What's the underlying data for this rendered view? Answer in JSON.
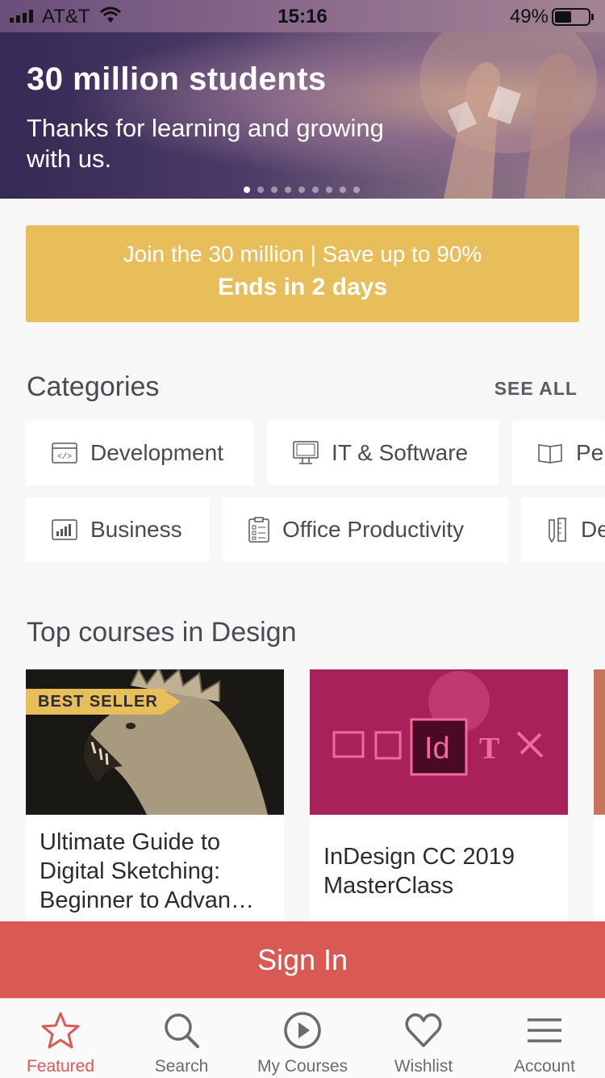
{
  "status_bar": {
    "carrier": "AT&T",
    "time": "15:16",
    "battery": "49%"
  },
  "hero": {
    "title": "30 million students",
    "subtitle": "Thanks for learning and growing with us.",
    "slide_count": 9,
    "active_slide": 1
  },
  "promo": {
    "line1": "Join the 30 million | Save up to 90%",
    "line2": "Ends in 2 days"
  },
  "categories": {
    "title": "Categories",
    "see_all": "SEE ALL",
    "row1": [
      "Development",
      "IT & Software",
      "Per"
    ],
    "row2": [
      "Business",
      "Office Productivity",
      "De"
    ]
  },
  "top_courses": {
    "title": "Top courses in Design",
    "cards": [
      {
        "badge": "BEST SELLER",
        "title": "Ultimate Guide to Digital Sketching: Beginner to Advan…"
      },
      {
        "title": "InDesign CC 2019 MasterClass",
        "thumb_text": "Id"
      }
    ]
  },
  "sign_in": "Sign In",
  "tabs": [
    {
      "label": "Featured",
      "icon": "star-icon",
      "active": true
    },
    {
      "label": "Search",
      "icon": "search-icon"
    },
    {
      "label": "My Courses",
      "icon": "play-icon"
    },
    {
      "label": "Wishlist",
      "icon": "heart-icon"
    },
    {
      "label": "Account",
      "icon": "menu-icon"
    }
  ],
  "colors": {
    "accent": "#d95a55",
    "promo": "#e8be5b"
  }
}
